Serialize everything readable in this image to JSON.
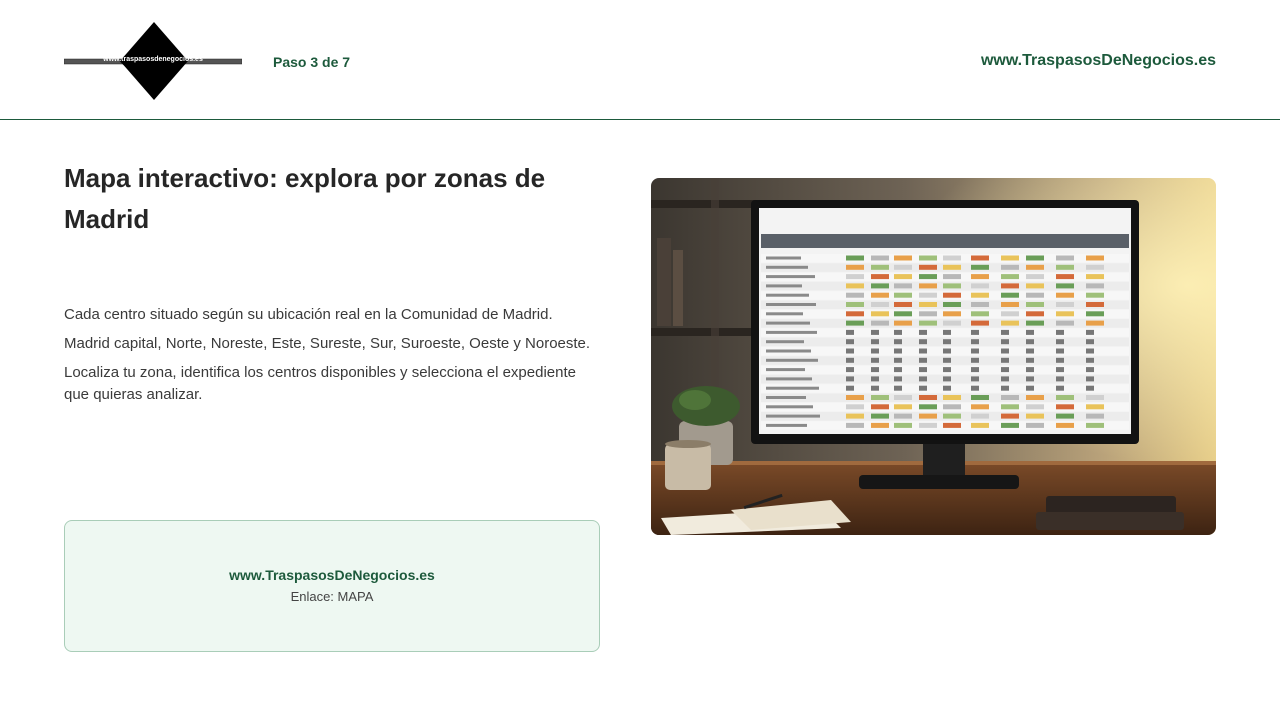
{
  "header": {
    "logo_text": "www.traspasosdenegocios.es",
    "step_label": "Paso 3 de 7",
    "site_link": "www.TraspasosDeNegocios.es"
  },
  "main": {
    "title": "Mapa interactivo: explora por zonas de Madrid",
    "paragraphs": [
      "Cada centro situado según su ubicación real en la Comunidad de Madrid.",
      "Madrid capital, Norte, Noreste, Este, Sureste, Sur, Suroeste, Oeste y Noroeste.",
      "Localiza tu zona, identifica los centros disponibles y selecciona el expediente que quieras analizar."
    ]
  },
  "link_box": {
    "site": "www.TraspasosDeNegocios.es",
    "enlace": "Enlace: MAPA"
  },
  "photo": {
    "subject": "monitor-with-spreadsheet-icon"
  },
  "colors": {
    "brand_green": "#1d5a3c",
    "box_bg": "#eef8f2",
    "box_border": "#a9cdb8"
  }
}
